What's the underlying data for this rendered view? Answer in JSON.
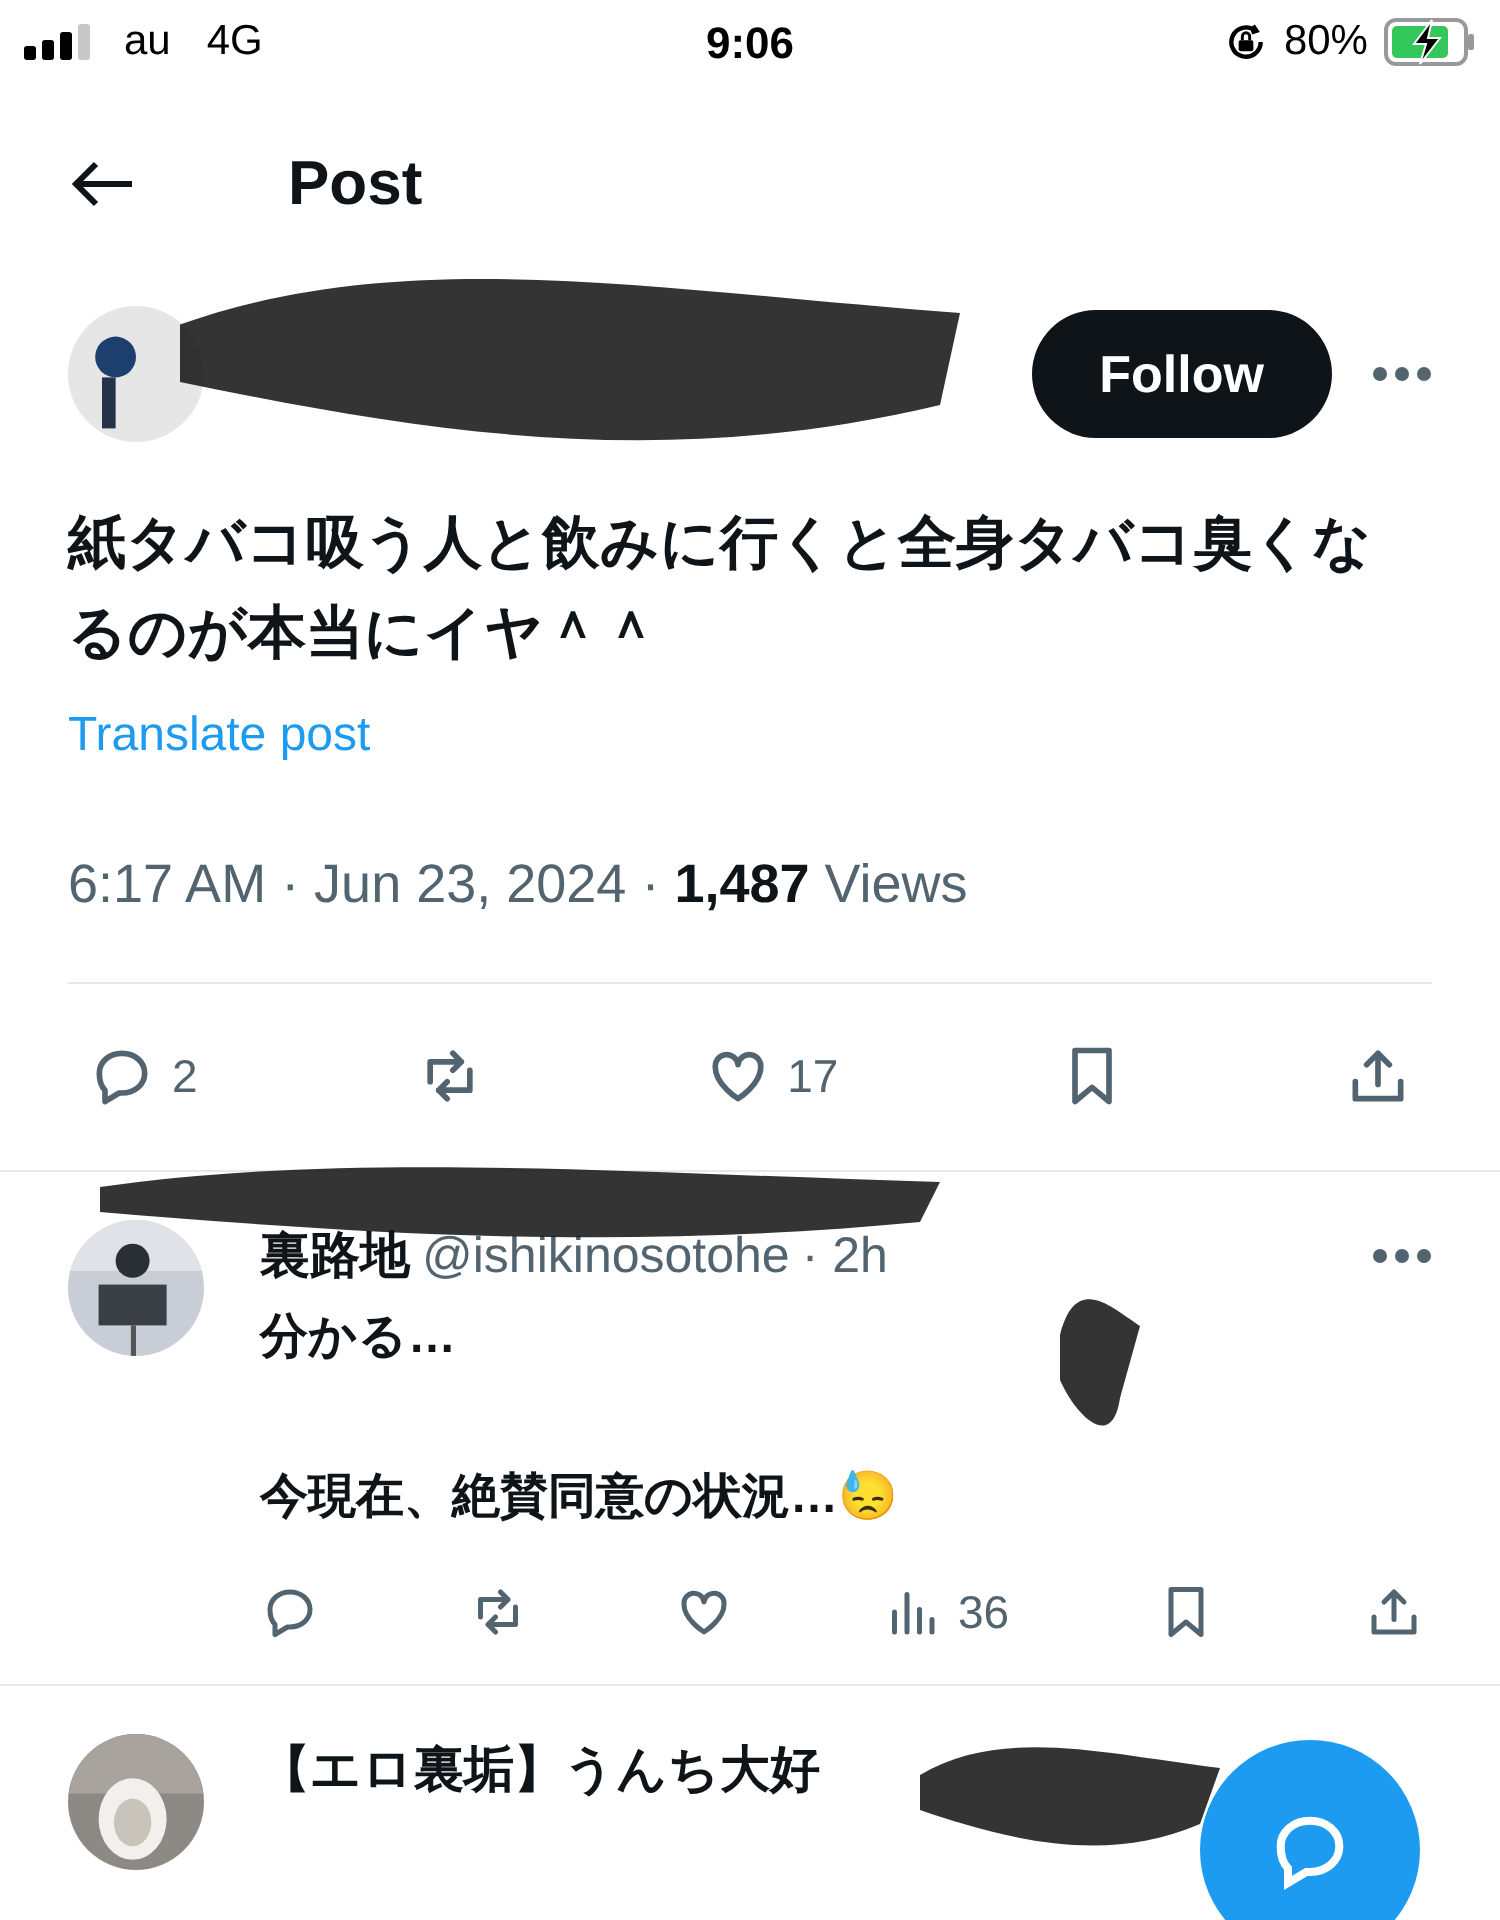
{
  "status_bar": {
    "carrier": "au",
    "network": "4G",
    "time": "9:06",
    "battery": "80%",
    "charging": true
  },
  "header": {
    "title": "Post"
  },
  "post": {
    "follow_label": "Follow",
    "text": "紙タバコ吸う人と飲みに行くと全身タバコ臭くなるのが本当にイヤ＾＾",
    "translate": "Translate post",
    "time": "6:17 AM · Jun 23, 2024 · ",
    "views_count": "1,487",
    "views_label": " Views",
    "actions": [
      {
        "kind": "reply",
        "count": "2"
      },
      {
        "kind": "repost"
      },
      {
        "kind": "like",
        "count": "17"
      },
      {
        "kind": "bookmark"
      },
      {
        "kind": "share"
      }
    ]
  },
  "replies": [
    {
      "name": "裏路地",
      "handle": "@ishikinosotohe",
      "time": "· 2h",
      "text": "分かる…\n\n今現在、絶賛同意の状況…😓",
      "actions": [
        {
          "kind": "reply"
        },
        {
          "kind": "repost"
        },
        {
          "kind": "like"
        },
        {
          "kind": "views",
          "count": "36"
        },
        {
          "kind": "bookmark"
        },
        {
          "kind": "share"
        }
      ]
    },
    {
      "name": "【エロ裏垢】うんち大好"
    }
  ]
}
